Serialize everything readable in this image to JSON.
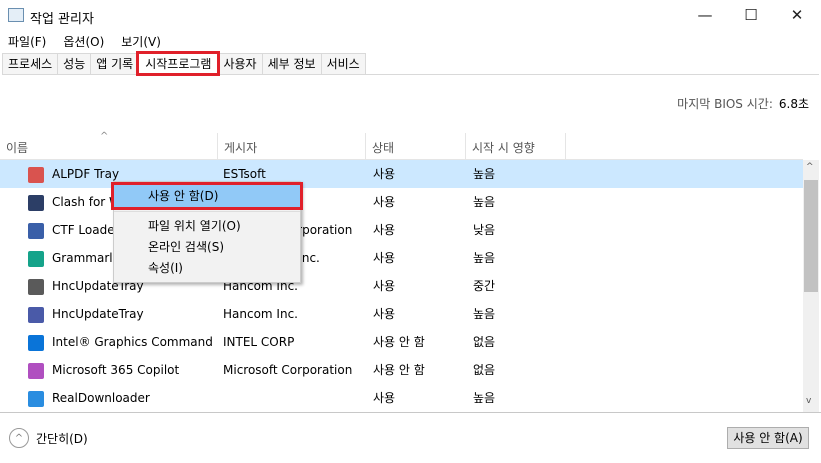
{
  "window": {
    "title": "작업 관리자",
    "minimize": "—",
    "maximize": "☐",
    "close": "✕"
  },
  "menu": [
    "파일(F)",
    "옵션(O)",
    "보기(V)"
  ],
  "tabs": [
    "프로세스",
    "성능",
    "앱 기록",
    "시작프로그램",
    "사용자",
    "세부 정보",
    "서비스"
  ],
  "bios": {
    "label": "마지막 BIOS 시간:",
    "value": "6.8초"
  },
  "columns": [
    "이름",
    "게시자",
    "상태",
    "시작 시 영향"
  ],
  "rows": [
    {
      "name": "ALPDF Tray",
      "publisher": "ESTsoft",
      "status": "사용",
      "impact": "높음",
      "icon": "alpdf-icon",
      "color": "#d9534f"
    },
    {
      "name": "Clash for Windows",
      "publisher": "",
      "status": "사용",
      "impact": "높음",
      "icon": "clash-icon",
      "color": "#2c3e66"
    },
    {
      "name": "CTF Loader",
      "publisher": "Microsoft Corporation",
      "status": "사용",
      "impact": "낮음",
      "icon": "ctf-loader-icon",
      "color": "#3a5fa8"
    },
    {
      "name": "Grammarly",
      "publisher": "Grammarly, Inc.",
      "status": "사용",
      "impact": "높음",
      "icon": "grammarly-icon",
      "color": "#15a38a"
    },
    {
      "name": "HncUpdateTray",
      "publisher": "Hancom Inc.",
      "status": "사용",
      "impact": "중간",
      "icon": "hnc-update-icon",
      "color": "#5a5a5a"
    },
    {
      "name": "HncUpdateTray",
      "publisher": "Hancom Inc.",
      "status": "사용",
      "impact": "높음",
      "icon": "hnc-update-icon",
      "color": "#4a5aa8"
    },
    {
      "name": "Intel® Graphics Command ...",
      "publisher": "INTEL CORP",
      "status": "사용 안 함",
      "impact": "없음",
      "icon": "intel-graphics-icon",
      "color": "#0a74d8"
    },
    {
      "name": "Microsoft 365 Copilot",
      "publisher": "Microsoft Corporation",
      "status": "사용 안 함",
      "impact": "없음",
      "icon": "copilot-icon",
      "color": "#b04fc0"
    },
    {
      "name": "RealDownloader",
      "publisher": "",
      "status": "사용",
      "impact": "높음",
      "icon": "realdownloader-icon",
      "color": "#2a8de0"
    }
  ],
  "context_menu": [
    "사용 안 함(D)",
    "파일 위치 열기(O)",
    "온라인 검색(S)",
    "속성(I)"
  ],
  "footer": {
    "collapse": "간단히(D)",
    "disable_button": "사용 안 함(A)"
  }
}
